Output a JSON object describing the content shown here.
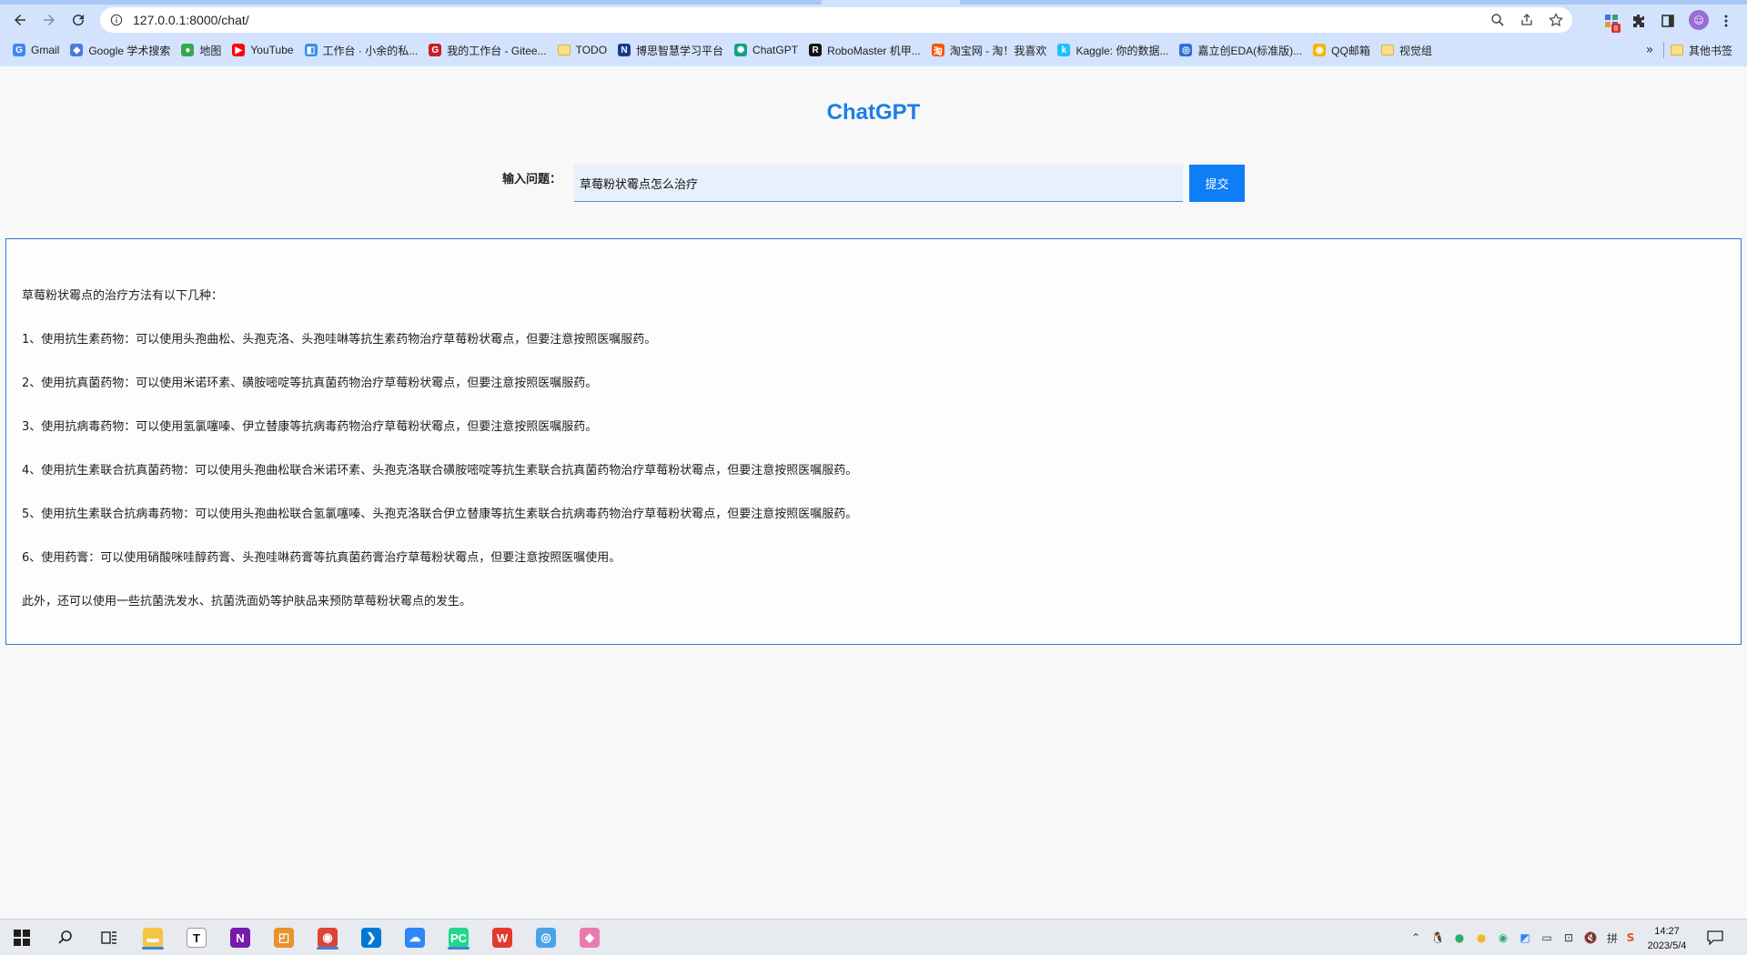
{
  "browser": {
    "url": "127.0.0.1:8000/chat/",
    "extension_badge": "8",
    "bookmarks": [
      {
        "label": "Gmail",
        "icon": "google-icon",
        "color": "#4285f4",
        "glyph": "G"
      },
      {
        "label": "Google 学术搜索",
        "icon": "scholar-icon",
        "color": "#4a7bd6",
        "glyph": "◆"
      },
      {
        "label": "地图",
        "icon": "maps-pin-icon",
        "color": "#34a853",
        "glyph": "●"
      },
      {
        "label": "YouTube",
        "icon": "youtube-icon",
        "color": "#ff0000",
        "glyph": "▶"
      },
      {
        "label": "工作台 · 小余的私...",
        "icon": "workspace-icon",
        "color": "#3a8ee6",
        "glyph": "◧"
      },
      {
        "label": "我的工作台 - Gitee...",
        "icon": "gitee-icon",
        "color": "#c71d23",
        "glyph": "G"
      },
      {
        "label": "TODO",
        "icon": "folder-icon",
        "color": "#fce083",
        "glyph": ""
      },
      {
        "label": "博思智慧学习平台",
        "icon": "boss-icon",
        "color": "#1a3b8f",
        "glyph": "N"
      },
      {
        "label": "ChatGPT",
        "icon": "openai-icon",
        "color": "#10a37f",
        "glyph": "✺"
      },
      {
        "label": "RoboMaster 机甲...",
        "icon": "robomaster-icon",
        "color": "#111111",
        "glyph": "R"
      },
      {
        "label": "淘宝网 - 淘！我喜欢",
        "icon": "taobao-icon",
        "color": "#ff5000",
        "glyph": "淘"
      },
      {
        "label": "Kaggle: 你的数据...",
        "icon": "kaggle-icon",
        "color": "#20beff",
        "glyph": "k"
      },
      {
        "label": "嘉立创EDA(标准版)...",
        "icon": "jlc-eda-icon",
        "color": "#2f6fd6",
        "glyph": "◎"
      },
      {
        "label": "QQ邮箱",
        "icon": "qqmail-icon",
        "color": "#f4b400",
        "glyph": "◉"
      },
      {
        "label": "视觉组",
        "icon": "folder-icon",
        "color": "#fce083",
        "glyph": ""
      }
    ],
    "other_bookmarks": "其他书签",
    "more_bookmarks": "»"
  },
  "page": {
    "title": "ChatGPT",
    "question_label": "输入问题：",
    "question_value": "草莓粉状霉点怎么治疗",
    "submit_label": "提交",
    "answer_lines": [
      "草莓粉状霉点的治疗方法有以下几种：",
      "1、使用抗生素药物：可以使用头孢曲松、头孢克洛、头孢哇啉等抗生素药物治疗草莓粉状霉点，但要注意按照医嘱服药。",
      "2、使用抗真菌药物：可以使用米诺环素、磺胺嘧啶等抗真菌药物治疗草莓粉状霉点，但要注意按照医嘱服药。",
      "3、使用抗病毒药物：可以使用氢氯噻嗪、伊立替康等抗病毒药物治疗草莓粉状霉点，但要注意按照医嘱服药。",
      "4、使用抗生素联合抗真菌药物：可以使用头孢曲松联合米诺环素、头孢克洛联合磺胺嘧啶等抗生素联合抗真菌药物治疗草莓粉状霉点，但要注意按照医嘱服药。",
      "5、使用抗生素联合抗病毒药物：可以使用头孢曲松联合氢氯噻嗪、头孢克洛联合伊立替康等抗生素联合抗病毒药物治疗草莓粉状霉点，但要注意按照医嘱服药。",
      "6、使用药膏：可以使用硝酸咪哇醇药膏、头孢哇啉药膏等抗真菌药膏治疗草莓粉状霉点，但要注意按照医嘱使用。",
      "此外，还可以使用一些抗菌洗发水、抗菌洗面奶等护肤品来预防草莓粉状霉点的发生。"
    ]
  },
  "taskbar": {
    "time": "14:27",
    "date": "2023/5/4",
    "apps": [
      {
        "name": "file-explorer-icon",
        "color": "#f4c542",
        "glyph": "▬",
        "active": true
      },
      {
        "name": "typora-icon",
        "color": "#ffffff",
        "glyph": "T",
        "active": false
      },
      {
        "name": "onenote-icon",
        "color": "#7719aa",
        "glyph": "N",
        "active": false
      },
      {
        "name": "office-icon",
        "color": "#e8912d",
        "glyph": "◰",
        "active": false
      },
      {
        "name": "chrome-icon",
        "color": "#db4437",
        "glyph": "◉",
        "active": true
      },
      {
        "name": "vscode-icon",
        "color": "#0078d4",
        "glyph": "❯",
        "active": false
      },
      {
        "name": "baidu-netdisk-icon",
        "color": "#2f86f6",
        "glyph": "☁",
        "active": false
      },
      {
        "name": "pycharm-icon",
        "color": "#21d789",
        "glyph": "PC",
        "active": true
      },
      {
        "name": "wps-icon",
        "color": "#e23a2c",
        "glyph": "W",
        "active": false
      },
      {
        "name": "browser-app-icon",
        "color": "#4ba3e6",
        "glyph": "◎",
        "active": false
      },
      {
        "name": "game-center-icon",
        "color": "#e97bb1",
        "glyph": "◆",
        "active": false
      }
    ]
  }
}
